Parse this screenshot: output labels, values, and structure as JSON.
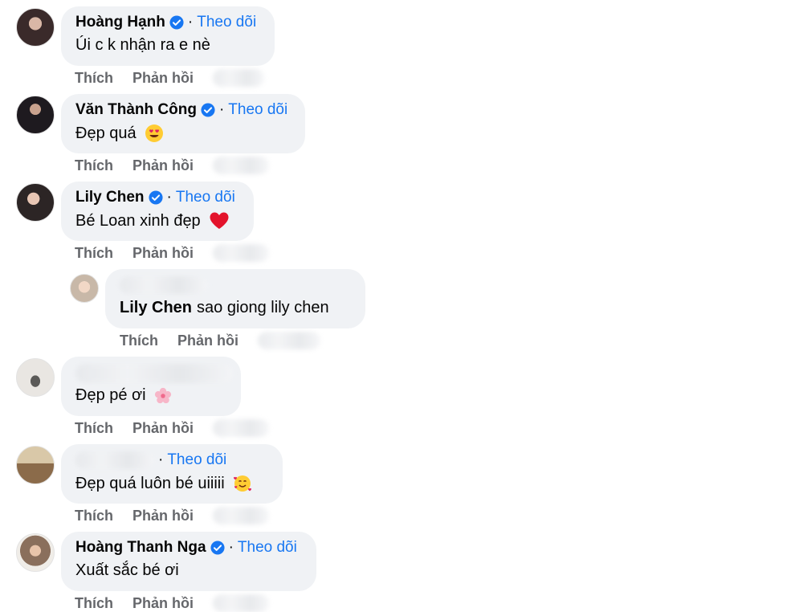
{
  "comments": [
    {
      "name": "Hoàng Hạnh",
      "verified": true,
      "follow": "Theo dõi",
      "text": "Úi c k nhận ra e nè",
      "avatar_color": "#3a2a2a",
      "like": "Thích",
      "reply": "Phản hồi"
    },
    {
      "name": "Văn Thành Công",
      "verified": true,
      "follow": "Theo dõi",
      "text": "Đẹp quá",
      "emoji": "heart-eyes-emoji",
      "avatar_color": "#1e1a1f",
      "like": "Thích",
      "reply": "Phản hồi"
    },
    {
      "name": "Lily Chen",
      "verified": true,
      "follow": "Theo dõi",
      "text": "Bé Loan xinh đẹp",
      "emoji": "red-heart-emoji",
      "avatar_color": "#2c2525",
      "like": "Thích",
      "reply": "Phản hồi"
    },
    {
      "mention": "Lily Chen",
      "text": "sao giong lily chen",
      "avatar_color": "#c8b8a8",
      "like": "Thích",
      "reply": "Phản hồi"
    },
    {
      "text": "Đẹp pé ơi",
      "emoji": "cherry-blossom-emoji",
      "avatar_color": "#e9e6e2",
      "like": "Thích",
      "reply": "Phản hồi"
    },
    {
      "follow": "Theo dõi",
      "text": "Đẹp quá luôn bé uiiiii",
      "emoji": "smiling-hearts-emoji",
      "avatar_color": "#b9a07a",
      "like": "Thích",
      "reply": "Phản hồi"
    },
    {
      "name": "Hoàng Thanh Nga",
      "verified": true,
      "follow": "Theo dõi",
      "text": "Xuất sắc bé ơi",
      "avatar_color": "#8a6f5c",
      "like": "Thích",
      "reply": "Phản hồi"
    }
  ],
  "colors": {
    "bubble": "#f0f2f5",
    "link": "#1877f2",
    "meta": "#65676b"
  }
}
